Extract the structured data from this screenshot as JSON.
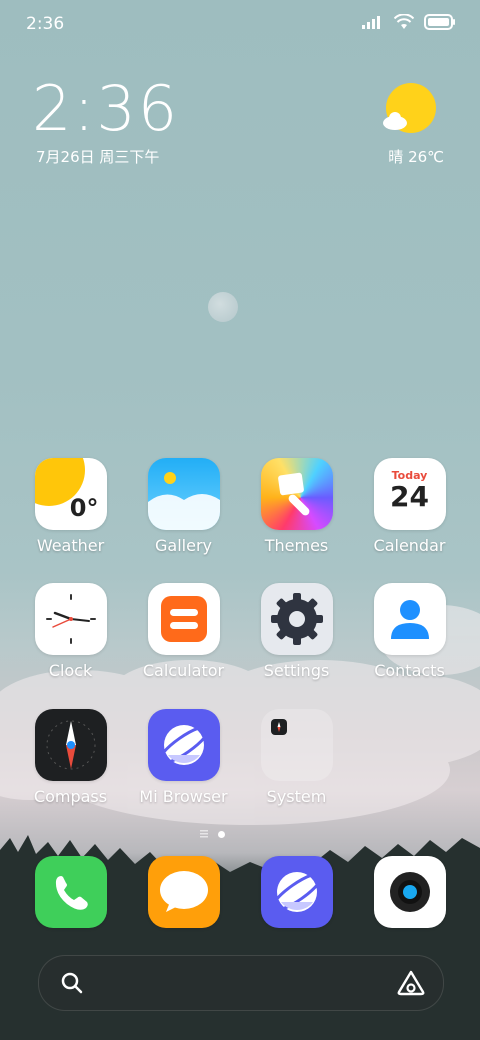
{
  "status": {
    "time": "2:36"
  },
  "clock_widget": {
    "time": "2:36",
    "date": "7月26日 周三下午"
  },
  "weather_widget": {
    "text": "晴 26℃"
  },
  "apps": {
    "weather": {
      "label": "Weather",
      "temp": "0°"
    },
    "gallery": {
      "label": "Gallery"
    },
    "themes": {
      "label": "Themes"
    },
    "calendar": {
      "label": "Calendar",
      "header": "Today",
      "day": "24"
    },
    "clock": {
      "label": "Clock"
    },
    "calculator": {
      "label": "Calculator"
    },
    "settings": {
      "label": "Settings"
    },
    "contacts": {
      "label": "Contacts"
    },
    "compass": {
      "label": "Compass"
    },
    "browser": {
      "label": "Mi Browser"
    },
    "system": {
      "label": "System"
    }
  },
  "page_indicator": {
    "pages": 2,
    "current": 2
  },
  "colors": {
    "accent_red": "#e94b3c",
    "browser_blue": "#5a5cf0",
    "phone_green": "#3fcf5a",
    "messages_orange": "#ff9f0a"
  }
}
